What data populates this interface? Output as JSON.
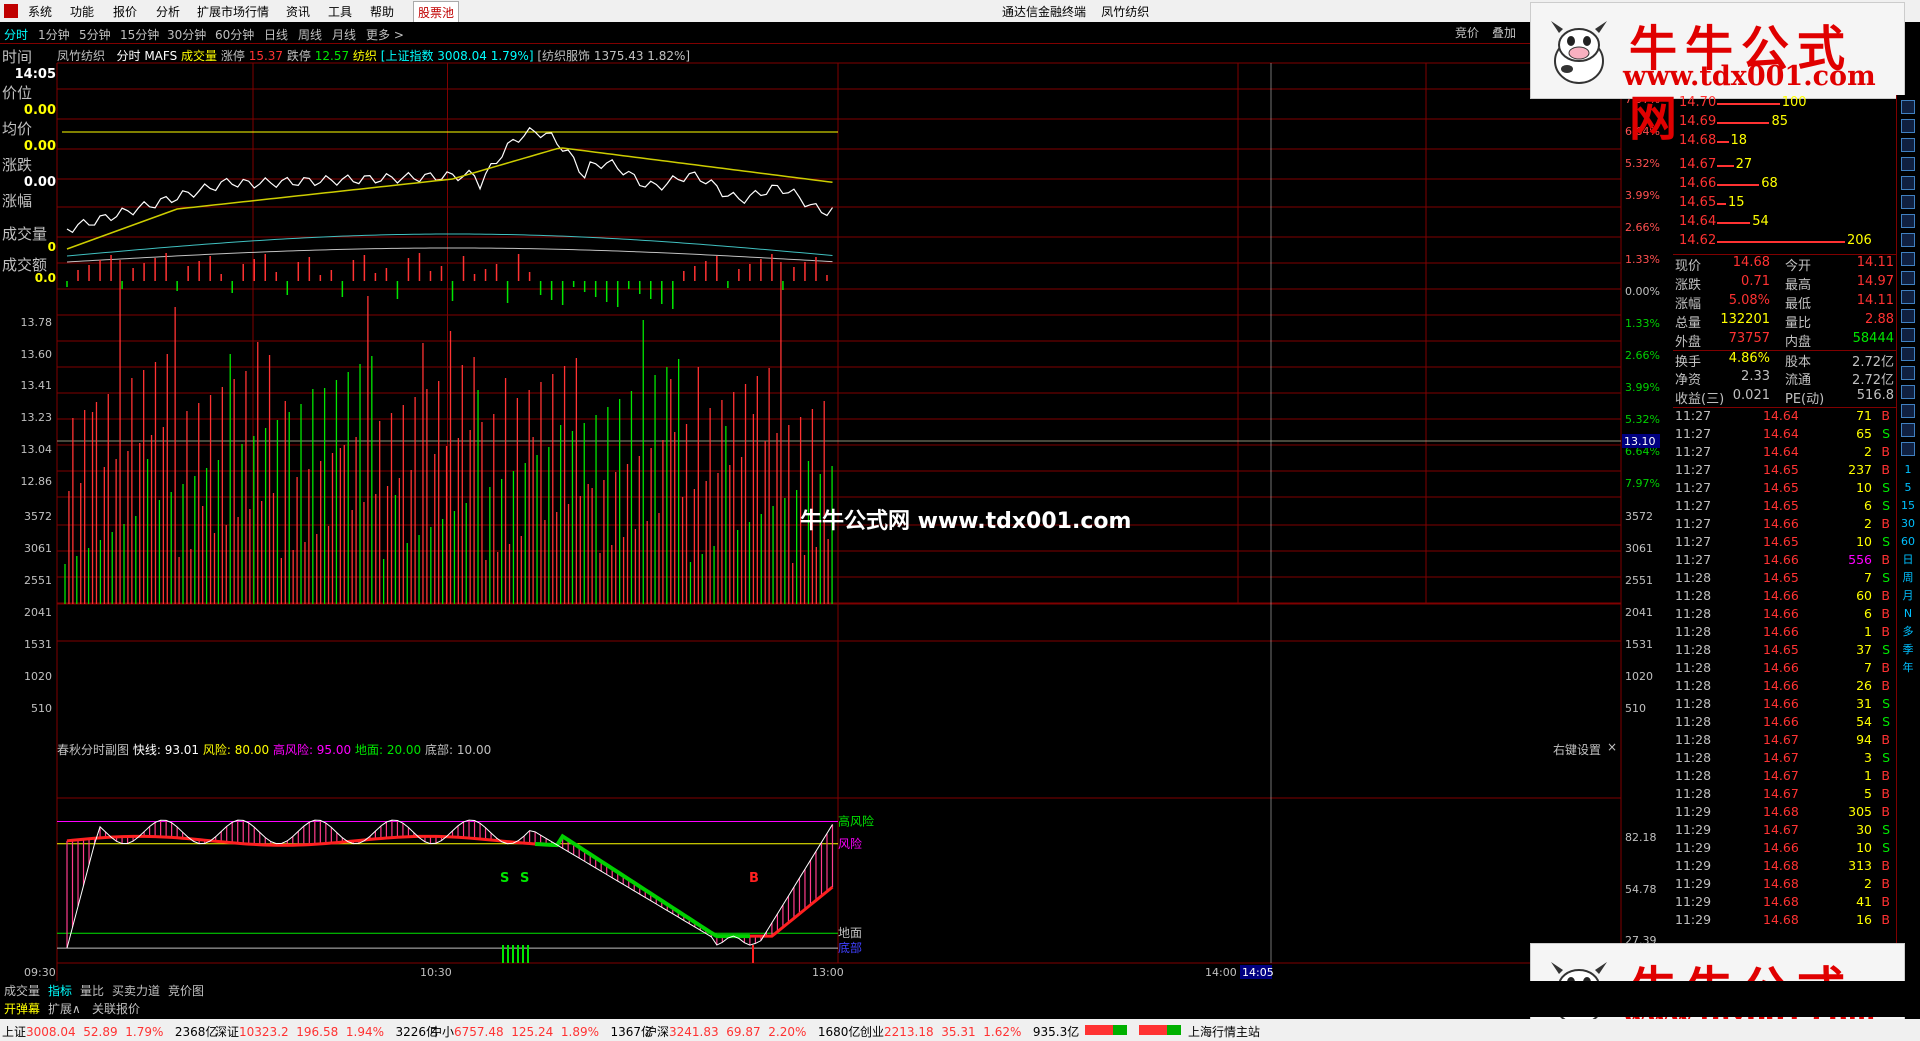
{
  "menu": {
    "items": [
      "系统",
      "功能",
      "报价",
      "分析",
      "扩展市场行情",
      "资讯",
      "工具",
      "帮助",
      "股票池"
    ],
    "app_title": "通达信金融终端",
    "stock_title": "凤竹纺织"
  },
  "tabs": {
    "items": [
      "分时",
      "1分钟",
      "5分钟",
      "15分钟",
      "30分钟",
      "60分钟",
      "日线",
      "周线",
      "月线",
      "更多 >"
    ],
    "right": [
      "竞价",
      "叠加"
    ]
  },
  "left_panel": {
    "time_label": "时间",
    "time_value": "14:05",
    "price_label": "价位",
    "price_value": "0.00",
    "avg_label": "均价",
    "avg_value": "0.00",
    "change_label": "涨跌",
    "change_value": "0.00",
    "pct_label": "涨幅",
    "vol_label": "成交量",
    "vol_value": "0",
    "amt_label": "成交额",
    "amt_value": "0.0"
  },
  "info_line": {
    "name": "凤竹纺织",
    "mode": "分时",
    "ind": "MAFS",
    "vol": "成交量",
    "up_lbl": "涨停",
    "up_val": "15.37",
    "down_lbl": "跌停",
    "down_val": "12.57",
    "sector": "纺织",
    "index": "[上证指数 3008.04 1.79%]",
    "sector_idx": "[纺织服饰 1375.43 1.82%]"
  },
  "price_axis": {
    "left": [
      "13.78",
      "13.60",
      "13.41",
      "13.23",
      "13.04",
      "12.86"
    ],
    "right_top": [
      "7.97%",
      "6.64%",
      "5.32%",
      "3.99%",
      "2.66%",
      "1.33%",
      "0.00%",
      "1.33%",
      "2.66%",
      "3.99%",
      "5.32%",
      "6.64%",
      "7.97%"
    ],
    "crosshair": "13.10"
  },
  "vol_axis": {
    "left": [
      "3572",
      "3061",
      "2551",
      "2041",
      "1531",
      "1020",
      "510"
    ],
    "right": [
      "3572",
      "3061",
      "2551",
      "2041",
      "1531",
      "1020",
      "510"
    ]
  },
  "indicator": {
    "title": "春秋分时副图",
    "fast": "快线: 93.01",
    "risk": "风险: 80.00",
    "high_risk": "高风险: 95.00",
    "ground": "地面: 20.00",
    "bottom": "底部: 10.00",
    "setting": "右键设置",
    "labels": {
      "high": "高风险",
      "risk": "风险",
      "ground": "地面",
      "bottom": "底部"
    },
    "axis": [
      "82.18",
      "54.78",
      "27.39"
    ],
    "signals": {
      "s": "S",
      "b": "B"
    }
  },
  "time_axis": [
    "09:30",
    "10:30",
    "13:00",
    "14:00",
    "14:05"
  ],
  "watermark": "牛牛公式网 www.tdx001.com",
  "brand": {
    "name": "牛牛公式网",
    "url": "www.tdx001.com"
  },
  "order_book": [
    {
      "price": "14.70",
      "qty": "100",
      "len": 0.49
    },
    {
      "price": "14.69",
      "qty": "85",
      "len": 0.41
    },
    {
      "price": "14.68",
      "qty": "18",
      "len": 0.09
    },
    {
      "price": "14.67",
      "qty": "27",
      "len": 0.13
    },
    {
      "price": "14.66",
      "qty": "68",
      "len": 0.33
    },
    {
      "price": "14.65",
      "qty": "15",
      "len": 0.07
    },
    {
      "price": "14.64",
      "qty": "54",
      "len": 0.26
    },
    {
      "price": "14.62",
      "qty": "206",
      "len": 1.0
    }
  ],
  "quote": [
    [
      "现价",
      "14.68",
      "今开",
      "14.11"
    ],
    [
      "涨跌",
      "0.71",
      "最高",
      "14.97"
    ],
    [
      "涨幅",
      "5.08%",
      "最低",
      "14.11"
    ],
    [
      "总量",
      "132201",
      "量比",
      "2.88"
    ],
    [
      "外盘",
      "73757",
      "内盘",
      "58444"
    ],
    [
      "换手",
      "4.86%",
      "股本",
      "2.72亿"
    ],
    [
      "净资",
      "2.33",
      "流通",
      "2.72亿"
    ],
    [
      "收益(三)",
      "0.021",
      "PE(动)",
      "516.8"
    ]
  ],
  "ticks": [
    [
      "11:27",
      "14.64",
      "71",
      "B"
    ],
    [
      "11:27",
      "14.64",
      "65",
      "S"
    ],
    [
      "11:27",
      "14.64",
      "2",
      "B"
    ],
    [
      "11:27",
      "14.65",
      "237",
      "B"
    ],
    [
      "11:27",
      "14.65",
      "10",
      "S"
    ],
    [
      "11:27",
      "14.65",
      "6",
      "S"
    ],
    [
      "11:27",
      "14.66",
      "2",
      "B"
    ],
    [
      "11:27",
      "14.65",
      "10",
      "S"
    ],
    [
      "11:27",
      "14.66",
      "556",
      "B"
    ],
    [
      "11:28",
      "14.65",
      "7",
      "S"
    ],
    [
      "11:28",
      "14.66",
      "60",
      "B"
    ],
    [
      "11:28",
      "14.66",
      "6",
      "B"
    ],
    [
      "11:28",
      "14.66",
      "1",
      "B"
    ],
    [
      "11:28",
      "14.65",
      "37",
      "S"
    ],
    [
      "11:28",
      "14.66",
      "7",
      "B"
    ],
    [
      "11:28",
      "14.66",
      "26",
      "B"
    ],
    [
      "11:28",
      "14.66",
      "31",
      "S"
    ],
    [
      "11:28",
      "14.66",
      "54",
      "S"
    ],
    [
      "11:28",
      "14.67",
      "94",
      "B"
    ],
    [
      "11:28",
      "14.67",
      "3",
      "S"
    ],
    [
      "11:28",
      "14.67",
      "1",
      "B"
    ],
    [
      "11:28",
      "14.67",
      "5",
      "B"
    ],
    [
      "11:29",
      "14.68",
      "305",
      "B"
    ],
    [
      "11:29",
      "14.67",
      "30",
      "S"
    ],
    [
      "11:29",
      "14.66",
      "10",
      "S"
    ],
    [
      "11:29",
      "14.68",
      "313",
      "B"
    ],
    [
      "11:29",
      "14.68",
      "2",
      "B"
    ],
    [
      "11:29",
      "14.68",
      "41",
      "B"
    ],
    [
      "11:29",
      "14.68",
      "16",
      "B"
    ]
  ],
  "sidebar_icons": [
    "1",
    "5",
    "15",
    "30",
    "60",
    "日",
    "周",
    "月",
    "N",
    "多",
    "季",
    "年"
  ],
  "bottom_tabs": [
    "成交量",
    "指标",
    "量比",
    "买卖力道",
    "竞价图"
  ],
  "bottom_tabs2": [
    "开弹幕",
    "扩展∧",
    "关联报价"
  ],
  "status": {
    "sh": [
      "上证",
      "3008.04",
      "52.89",
      "1.79%",
      "2368亿"
    ],
    "sz": [
      "深证",
      "10323.2",
      "196.58",
      "1.94%",
      "3226亿"
    ],
    "zx": [
      "中小",
      "6757.48",
      "125.24",
      "1.89%",
      "1367亿"
    ],
    "hs": [
      "沪深",
      "3241.83",
      "69.87",
      "2.20%",
      "1680亿"
    ],
    "cy": [
      "创业",
      "2213.18",
      "35.31",
      "1.62%",
      "935.3亿"
    ],
    "server": "上海行情主站"
  },
  "colors": {
    "up": "#ff3232",
    "down": "#00e600",
    "grid": "#800000",
    "price": "#ffffff",
    "avg": "#ffff00"
  }
}
